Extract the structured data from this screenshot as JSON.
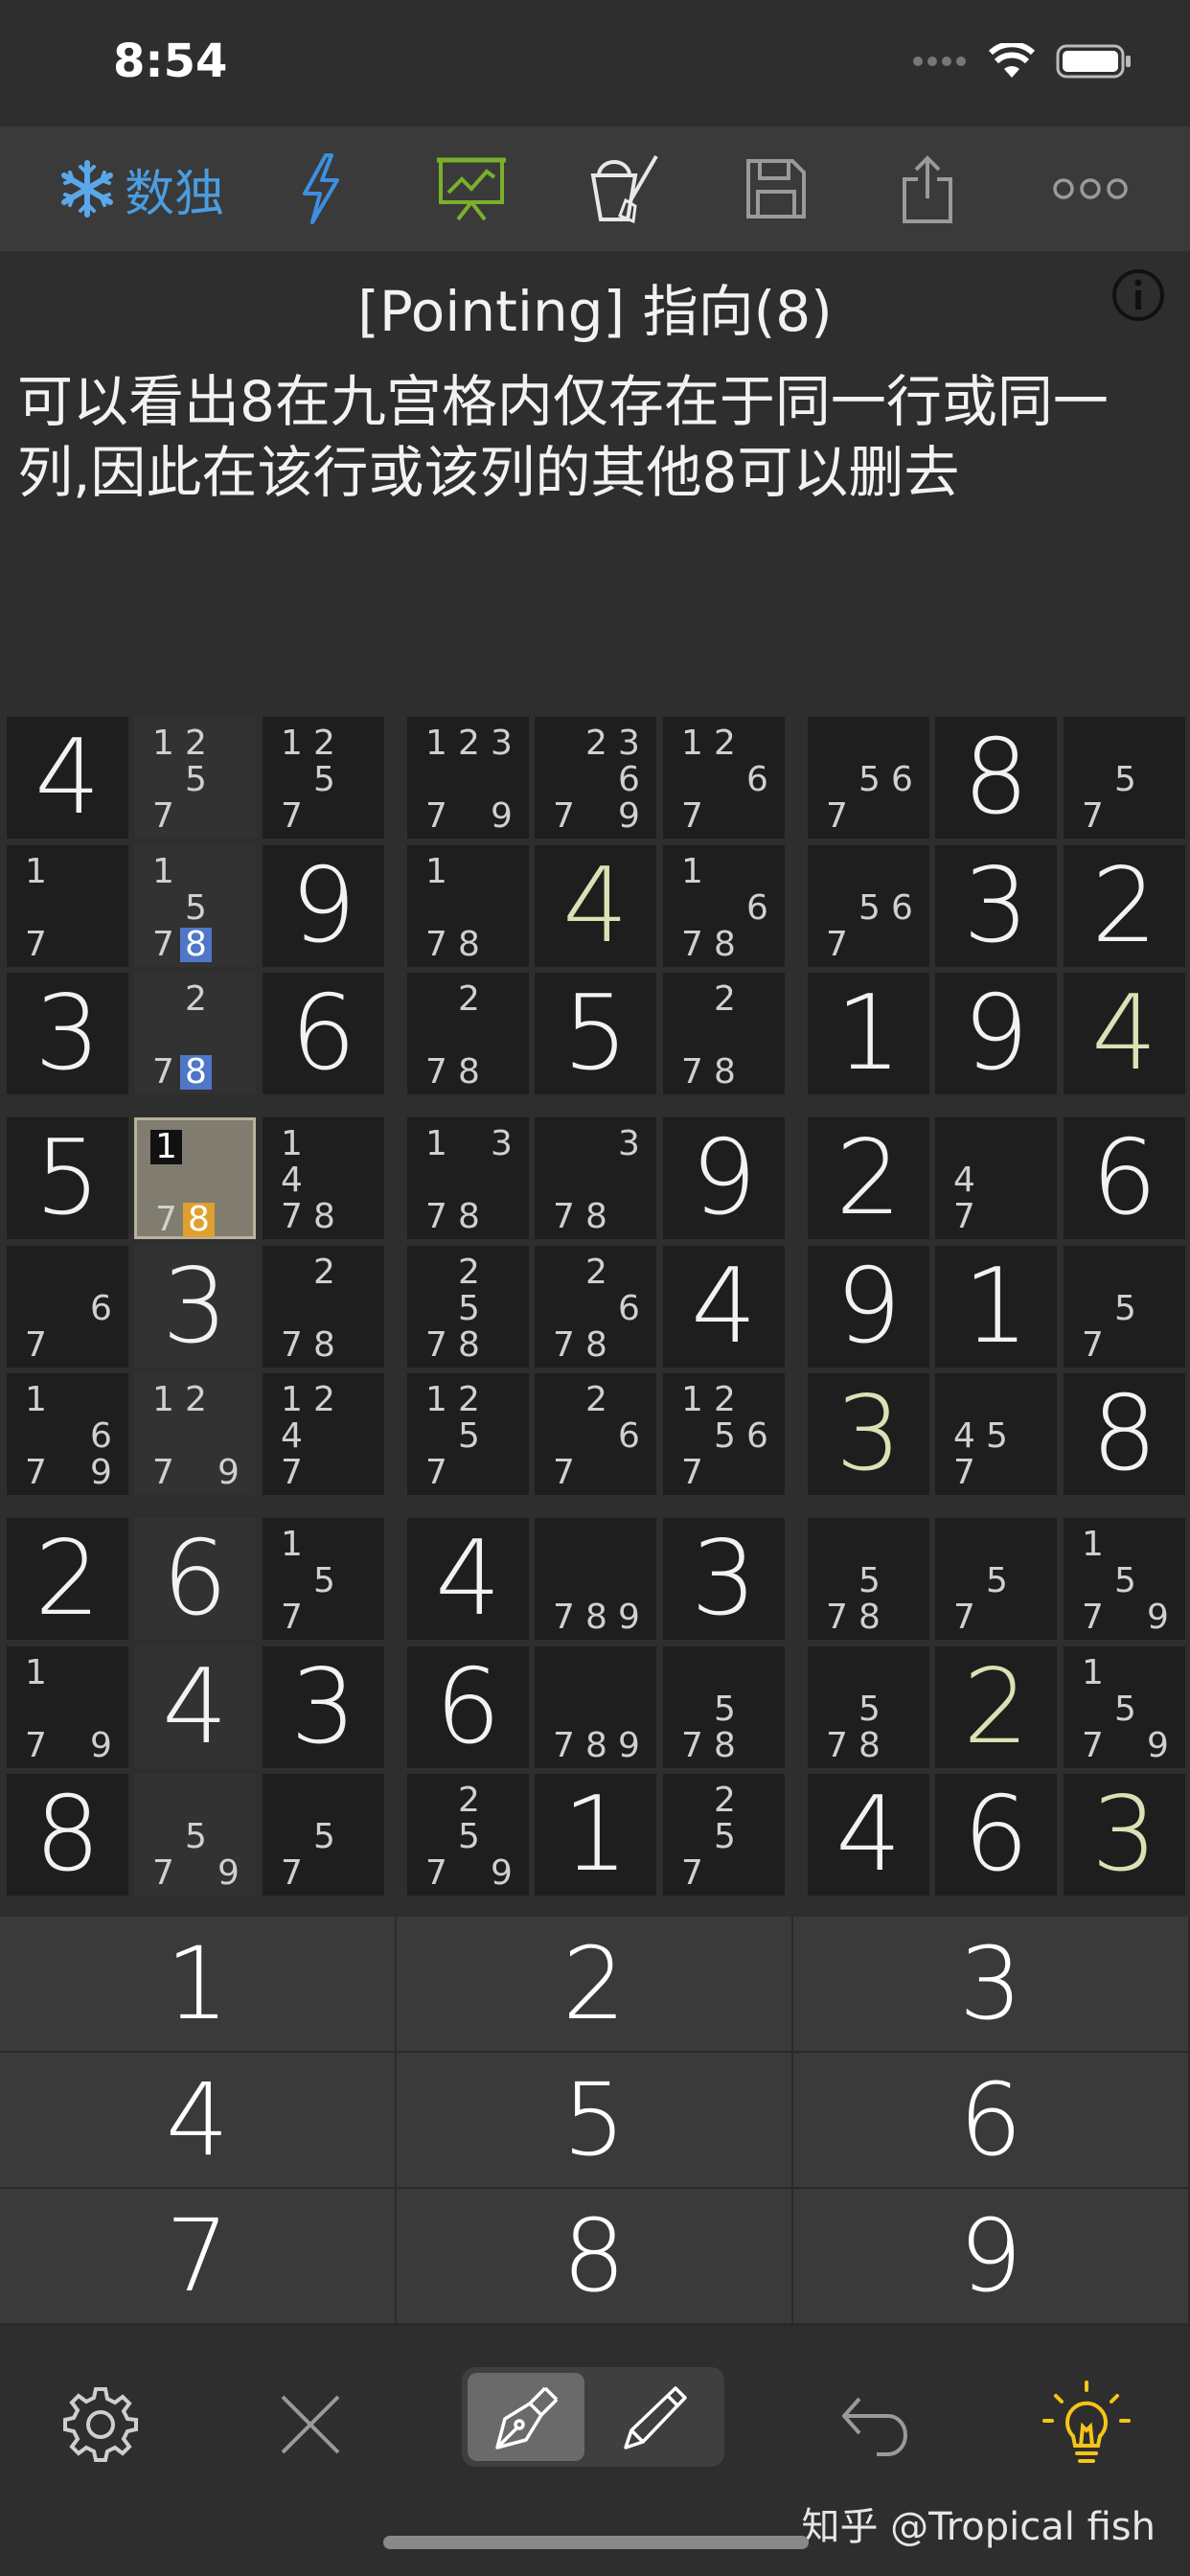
{
  "status_bar": {
    "time": "8:54"
  },
  "toolbar": {
    "app_name": "数独"
  },
  "hint": {
    "title": "[Pointing] 指向(8)",
    "text": "可以看出8在九宫格内仅存在于同一行或同一列,因此在该行或该列的其他8可以删去"
  },
  "grid": {
    "rows": [
      [
        {
          "v": "4"
        },
        {
          "c": [
            "1",
            "2",
            "5",
            "7"
          ]
        },
        {
          "c": [
            "1",
            "2",
            "5",
            "7"
          ]
        },
        {
          "c": [
            "1",
            "2",
            "3",
            "7",
            "9"
          ]
        },
        {
          "c": [
            "2",
            "3",
            "6",
            "7",
            "9"
          ]
        },
        {
          "c": [
            "1",
            "2",
            "6",
            "7"
          ]
        },
        {
          "c": [
            "5",
            "6",
            "7"
          ]
        },
        {
          "v": "8"
        },
        {
          "c": [
            "5",
            "7"
          ]
        }
      ],
      [
        {
          "c": [
            "1",
            "7"
          ]
        },
        {
          "c": [
            "1",
            "5",
            "7",
            "8"
          ]
        },
        {
          "v": "9"
        },
        {
          "c": [
            "1",
            "7",
            "8"
          ]
        },
        {
          "v": "4",
          "u": true
        },
        {
          "c": [
            "1",
            "6",
            "7",
            "8"
          ]
        },
        {
          "c": [
            "5",
            "6",
            "7"
          ]
        },
        {
          "v": "3"
        },
        {
          "v": "2"
        }
      ],
      [
        {
          "v": "3"
        },
        {
          "c": [
            "2",
            "7",
            "8"
          ]
        },
        {
          "v": "6"
        },
        {
          "c": [
            "2",
            "7",
            "8"
          ]
        },
        {
          "v": "5"
        },
        {
          "c": [
            "2",
            "7",
            "8"
          ]
        },
        {
          "v": "1"
        },
        {
          "v": "9"
        },
        {
          "v": "4",
          "u": true
        }
      ],
      [
        {
          "v": "5"
        },
        {
          "c": [
            "1",
            "7",
            "8"
          ]
        },
        {
          "c": [
            "1",
            "4",
            "7",
            "8"
          ]
        },
        {
          "c": [
            "1",
            "3",
            "7",
            "8"
          ]
        },
        {
          "c": [
            "3",
            "7",
            "8"
          ]
        },
        {
          "v": "9"
        },
        {
          "v": "2"
        },
        {
          "c": [
            "4",
            "7"
          ]
        },
        {
          "v": "6"
        }
      ],
      [
        {
          "c": [
            "6",
            "7"
          ]
        },
        {
          "v": "3"
        },
        {
          "c": [
            "2",
            "7",
            "8"
          ]
        },
        {
          "c": [
            "2",
            "5",
            "7",
            "8"
          ]
        },
        {
          "c": [
            "2",
            "6",
            "7",
            "8"
          ]
        },
        {
          "v": "4"
        },
        {
          "v": "9"
        },
        {
          "v": "1"
        },
        {
          "c": [
            "5",
            "7"
          ]
        }
      ],
      [
        {
          "c": [
            "1",
            "6",
            "7",
            "9"
          ]
        },
        {
          "c": [
            "1",
            "2",
            "7",
            "9"
          ]
        },
        {
          "c": [
            "1",
            "2",
            "4",
            "7"
          ]
        },
        {
          "c": [
            "1",
            "2",
            "5",
            "7"
          ]
        },
        {
          "c": [
            "2",
            "6",
            "7"
          ]
        },
        {
          "c": [
            "1",
            "2",
            "5",
            "6",
            "7"
          ]
        },
        {
          "v": "3",
          "u": true
        },
        {
          "c": [
            "4",
            "5",
            "7"
          ]
        },
        {
          "v": "8"
        }
      ],
      [
        {
          "v": "2"
        },
        {
          "v": "6"
        },
        {
          "c": [
            "1",
            "5",
            "7"
          ]
        },
        {
          "v": "4"
        },
        {
          "c": [
            "7",
            "8",
            "9"
          ]
        },
        {
          "v": "3"
        },
        {
          "c": [
            "5",
            "7",
            "8"
          ]
        },
        {
          "c": [
            "5",
            "7"
          ]
        },
        {
          "c": [
            "1",
            "5",
            "7",
            "9"
          ]
        }
      ],
      [
        {
          "c": [
            "1",
            "7",
            "9"
          ]
        },
        {
          "v": "4"
        },
        {
          "v": "3"
        },
        {
          "v": "6"
        },
        {
          "c": [
            "7",
            "8",
            "9"
          ]
        },
        {
          "c": [
            "5",
            "7",
            "8"
          ]
        },
        {
          "c": [
            "5",
            "7",
            "8"
          ]
        },
        {
          "v": "2",
          "u": true
        },
        {
          "c": [
            "1",
            "5",
            "7",
            "9"
          ]
        }
      ],
      [
        {
          "v": "8"
        },
        {
          "c": [
            "5",
            "7",
            "9"
          ]
        },
        {
          "c": [
            "5",
            "7"
          ]
        },
        {
          "c": [
            "2",
            "5",
            "7",
            "9"
          ]
        },
        {
          "v": "1"
        },
        {
          "c": [
            "2",
            "5",
            "7"
          ]
        },
        {
          "v": "4"
        },
        {
          "v": "6"
        },
        {
          "v": "3",
          "u": true
        }
      ]
    ],
    "highlight": {
      "column_index": 1,
      "selected_cell": "r4c2",
      "pointing_candidate": "8",
      "pointing_cells": [
        "r2c2",
        "r3c2"
      ],
      "selected_candidate": "8",
      "selected_marked": "1",
      "colors": {
        "pointing": "#4f77c8",
        "target": "#e0a030",
        "selected_bg": "#807c70",
        "user_digit": "#d9e2b4"
      }
    }
  },
  "numpad": {
    "keys": [
      "1",
      "2",
      "3",
      "4",
      "5",
      "6",
      "7",
      "8",
      "9"
    ]
  },
  "bottom_bar": {
    "icons": [
      "gear-icon",
      "close-icon",
      "pen-icon",
      "pencil-icon",
      "undo-icon",
      "lightbulb-icon"
    ]
  },
  "watermark": "知乎 @Tropical fish"
}
